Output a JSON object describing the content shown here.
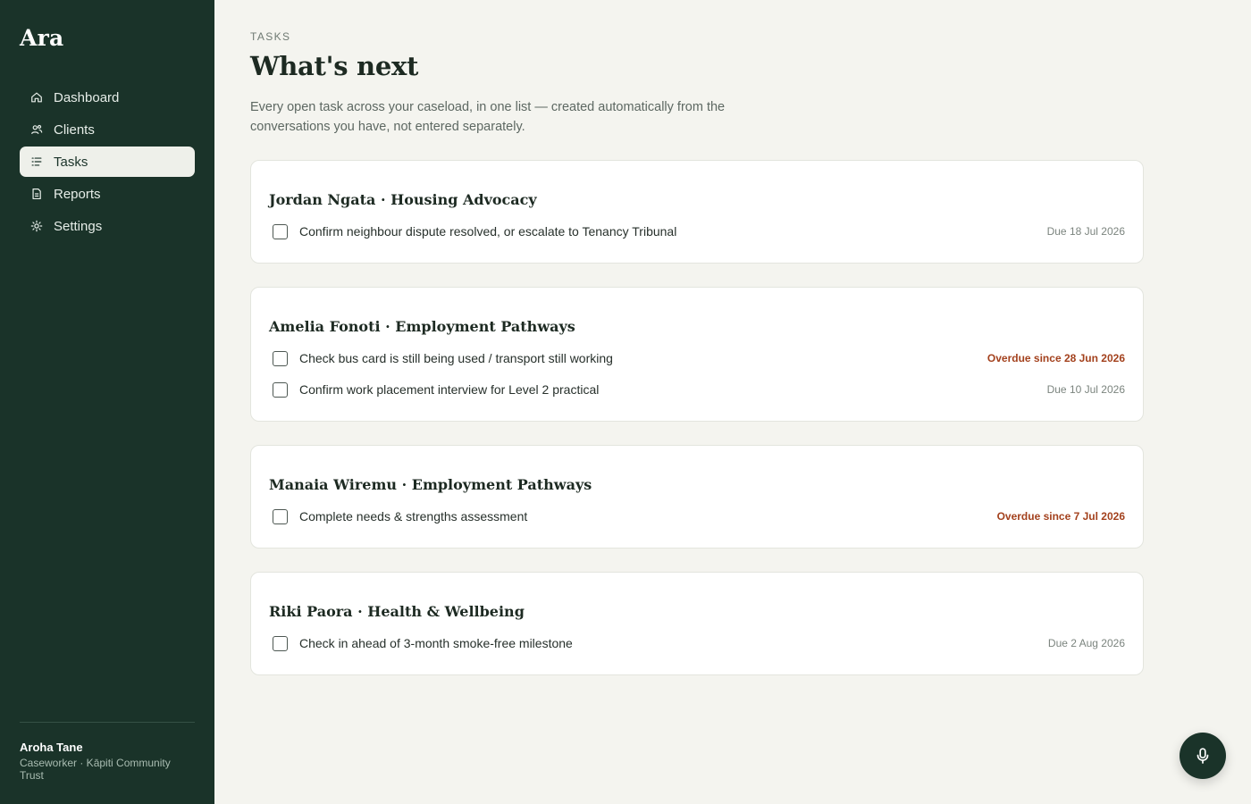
{
  "app": {
    "brand": "Ara"
  },
  "sidebar": {
    "items": [
      {
        "label": "Dashboard",
        "icon": "home-icon",
        "active": false
      },
      {
        "label": "Clients",
        "icon": "users-icon",
        "active": false
      },
      {
        "label": "Tasks",
        "icon": "list-icon",
        "active": true
      },
      {
        "label": "Reports",
        "icon": "document-icon",
        "active": false
      },
      {
        "label": "Settings",
        "icon": "gear-icon",
        "active": false
      }
    ],
    "user": {
      "name": "Aroha Tane",
      "role": "Caseworker · Kāpiti Community Trust"
    }
  },
  "page": {
    "eyebrow": "TASKS",
    "title": "What's next",
    "subtitle": "Every open task across your caseload, in one list — created automatically from the conversations you have, not entered separately."
  },
  "cards": [
    {
      "title": "Jordan Ngata · Housing Advocacy",
      "tasks": [
        {
          "text": "Confirm neighbour dispute resolved, or escalate to Tenancy Tribunal",
          "due": "Due 18 Jul 2026",
          "overdue": false
        }
      ]
    },
    {
      "title": "Amelia Fonoti · Employment Pathways",
      "tasks": [
        {
          "text": "Check bus card is still being used / transport still working",
          "due": "Overdue since 28 Jun 2026",
          "overdue": true
        },
        {
          "text": "Confirm work placement interview for Level 2 practical",
          "due": "Due 10 Jul 2026",
          "overdue": false
        }
      ]
    },
    {
      "title": "Manaia Wiremu · Employment Pathways",
      "tasks": [
        {
          "text": "Complete needs & strengths assessment",
          "due": "Overdue since 7 Jul 2026",
          "overdue": true
        }
      ]
    },
    {
      "title": "Riki Paora · Health & Wellbeing",
      "tasks": [
        {
          "text": "Check in ahead of 3-month smoke-free milestone",
          "due": "Due 2 Aug 2026",
          "overdue": false
        }
      ]
    }
  ],
  "fab": {
    "icon": "microphone-icon"
  },
  "colors": {
    "sidebar_bg": "#1a3329",
    "page_bg": "#f4f4ef",
    "overdue": "#a3411d",
    "accent": "#1a3329"
  }
}
